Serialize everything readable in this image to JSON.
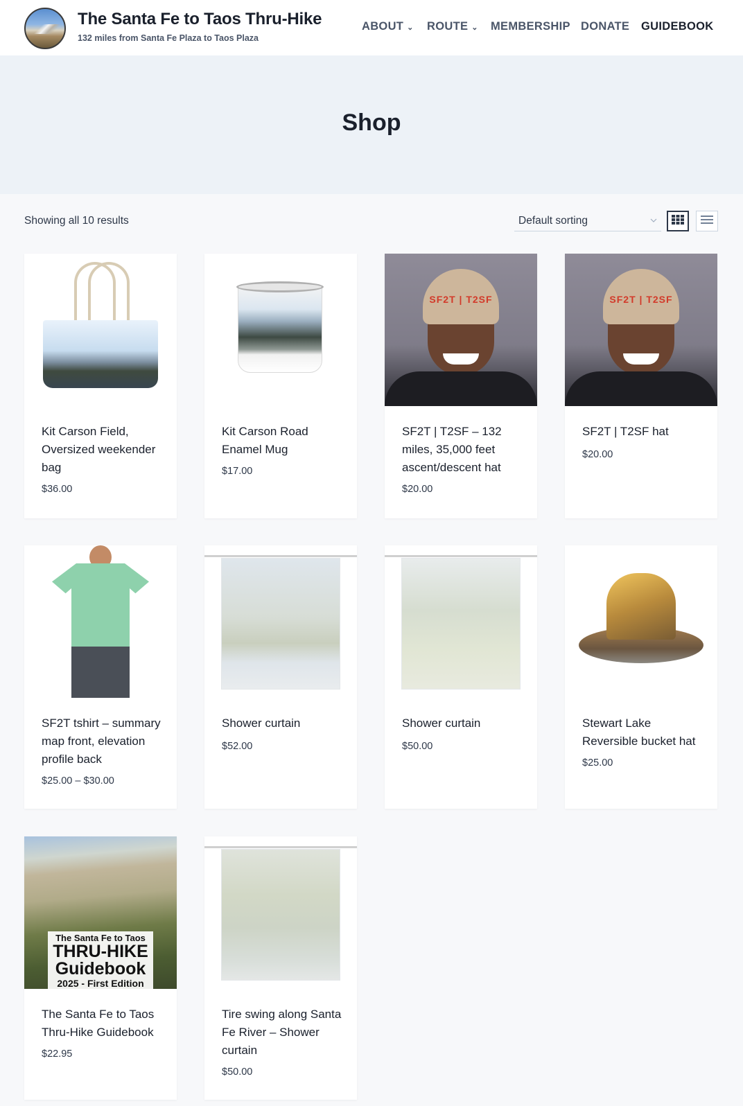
{
  "site": {
    "title": "The Santa Fe to Taos Thru-Hike",
    "tagline": "132 miles from Santa Fe Plaza to Taos Plaza"
  },
  "nav": {
    "about": "ABOUT",
    "route": "ROUTE",
    "membership": "MEMBERSHIP",
    "donate": "DONATE",
    "guidebook": "GUIDEBOOK",
    "chevron": "⌄"
  },
  "page": {
    "title": "Shop",
    "result_count": "Showing all 10 results",
    "sort_selected": "Default sorting"
  },
  "products": [
    {
      "title": "Kit Carson Field, Oversized weekender bag",
      "price": "$36.00",
      "image": "weekender-bag"
    },
    {
      "title": "Kit Carson Road Enamel Mug",
      "price": "$17.00",
      "image": "enamel-mug"
    },
    {
      "title": "SF2T | T2SF – 132 miles, 35,000 feet ascent/descent hat",
      "price": "$20.00",
      "image": "cap-photo"
    },
    {
      "title": "SF2T | T2SF hat",
      "price": "$20.00",
      "image": "cap-photo"
    },
    {
      "title": "SF2T tshirt – summary map front, elevation profile back",
      "price": "$25.00 – $30.00",
      "image": "tshirt"
    },
    {
      "title": "Shower curtain",
      "price": "$52.00",
      "image": "shower-curtain"
    },
    {
      "title": "Shower curtain",
      "price": "$50.00",
      "image": "shower-curtain"
    },
    {
      "title": "Stewart Lake Reversible bucket hat",
      "price": "$25.00",
      "image": "bucket-hat"
    },
    {
      "title": "The Santa Fe to Taos Thru-Hike Guidebook",
      "price": "$22.95",
      "image": "guidebook-cover"
    },
    {
      "title": "Tire swing along Santa Fe River – Shower curtain",
      "price": "$50.00",
      "image": "shower-curtain"
    }
  ],
  "images": {
    "cap_text": "SF2T | T2SF",
    "guide_line1": "The Santa Fe to Taos",
    "guide_line2": "THRU-HIKE",
    "guide_line3": "Guidebook",
    "guide_line4": "2025 - First Edition"
  },
  "colors": {
    "hero_bg": "#edf2f7",
    "page_bg": "#f7f8fa",
    "title_text": "#1a202c",
    "cap_red": "#d23a2a"
  }
}
